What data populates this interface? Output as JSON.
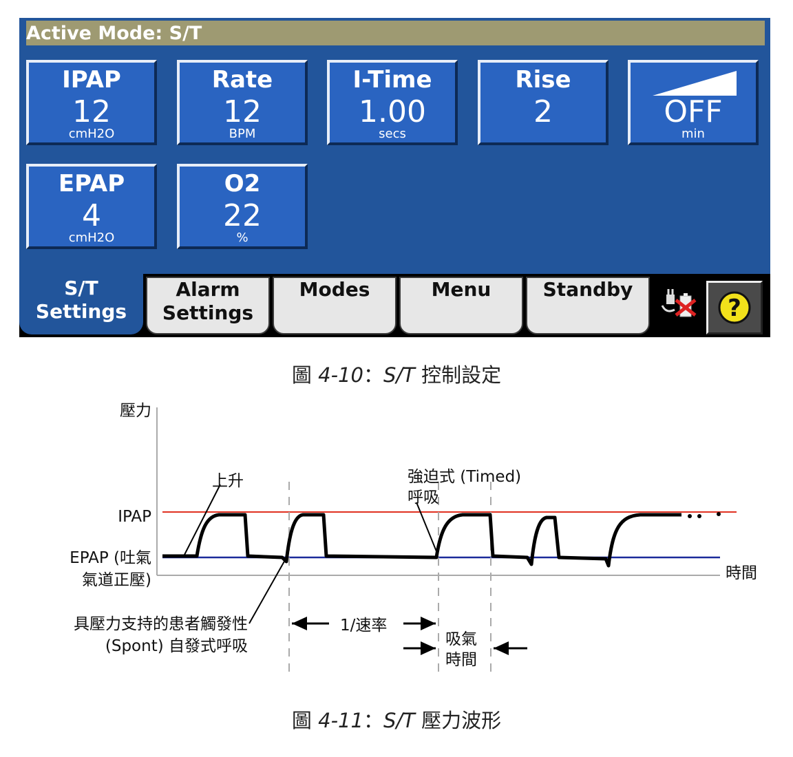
{
  "screen": {
    "mode_bar": "Active Mode:  S/T",
    "tiles": [
      {
        "label": "IPAP",
        "value": "12",
        "unit": "cmH2O"
      },
      {
        "label": "Rate",
        "value": "12",
        "unit": "BPM"
      },
      {
        "label": "I-Time",
        "value": "1.00",
        "unit": "secs"
      },
      {
        "label": "Rise",
        "value": "2",
        "unit": ""
      },
      {
        "label": "",
        "value": "OFF",
        "unit": "min",
        "icon": "ramp-icon"
      },
      {
        "label": "EPAP",
        "value": "4",
        "unit": "cmH2O"
      },
      {
        "label": "O2",
        "value": "22",
        "unit": "%"
      }
    ],
    "tabs": [
      {
        "line1": "S/T",
        "line2": "Settings",
        "active": true
      },
      {
        "line1": "Alarm",
        "line2": "Settings",
        "active": false
      },
      {
        "line1": "Modes",
        "line2": "",
        "active": false
      },
      {
        "line1": "Menu",
        "line2": "",
        "active": false
      },
      {
        "line1": "Standby",
        "line2": "",
        "active": false
      }
    ],
    "icons": [
      "ac-power-battery-icon",
      "help-icon"
    ],
    "help_symbol": "?",
    "colors": {
      "screen_bg": "#22559b",
      "tile_bg": "#2a64c1",
      "mode_bar": "#9e9a72",
      "help_yellow": "#f2e11b"
    }
  },
  "captions": {
    "fig10_prefix": "圖 ",
    "fig10_num": "4-10",
    "fig10_sep": "：",
    "fig10_mode": "S/T",
    "fig10_text": " 控制設定",
    "fig11_prefix": "圖 ",
    "fig11_num": "4-11",
    "fig11_sep": "：",
    "fig11_mode": "S/T",
    "fig11_text": " 壓力波形"
  },
  "waveform": {
    "y_axis_label": "壓力",
    "x_axis_label": "時間",
    "ipap_label": "IPAP",
    "epap_label_1": "EPAP (吐氣",
    "epap_label_2": "氣道正壓)",
    "rise_label": "上升",
    "timed_label_1": "強迫式 (Timed)",
    "timed_label_2": "呼吸",
    "spont_label_1": "具壓力支持的患者觸發性",
    "spont_label_2": "(Spont) 自發式呼吸",
    "rate_label": "1/速率",
    "itime_label_1": "吸氣",
    "itime_label_2": "時間",
    "colors": {
      "ipap_line": "#e03020",
      "epap_line": "#1a2a9a",
      "trace": "#000000"
    }
  }
}
